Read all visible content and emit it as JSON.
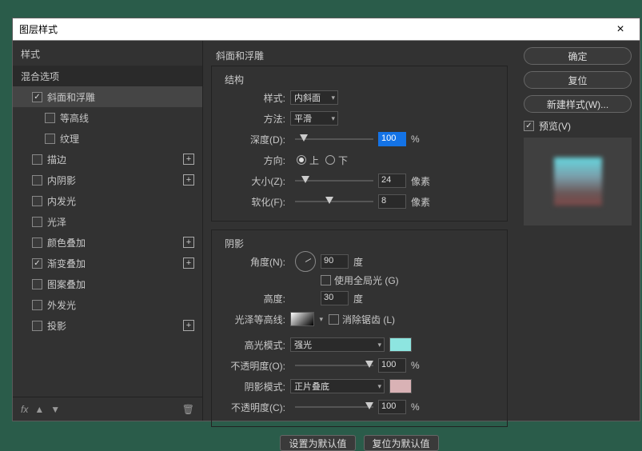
{
  "titlebar": {
    "title": "图层样式"
  },
  "left": {
    "header_styles": "样式",
    "blend_options": "混合选项",
    "items": [
      {
        "label": "斜面和浮雕",
        "checked": true,
        "selected": true
      },
      {
        "label": "等高线",
        "checked": false,
        "sub": true
      },
      {
        "label": "纹理",
        "checked": false,
        "sub": true
      },
      {
        "label": "描边",
        "checked": false,
        "add": true
      },
      {
        "label": "内阴影",
        "checked": false,
        "add": true
      },
      {
        "label": "内发光",
        "checked": false
      },
      {
        "label": "光泽",
        "checked": false
      },
      {
        "label": "颜色叠加",
        "checked": false,
        "add": true
      },
      {
        "label": "渐变叠加",
        "checked": true,
        "add": true
      },
      {
        "label": "图案叠加",
        "checked": false
      },
      {
        "label": "外发光",
        "checked": false
      },
      {
        "label": "投影",
        "checked": false,
        "add": true
      }
    ],
    "fx": "fx"
  },
  "mid": {
    "title": "斜面和浮雕",
    "structure": {
      "group": "结构",
      "style_lbl": "样式:",
      "style_val": "内斜面",
      "technique_lbl": "方法:",
      "technique_val": "平滑",
      "depth_lbl": "深度(D):",
      "depth_val": "100",
      "depth_unit": "%",
      "direction_lbl": "方向:",
      "dir_up": "上",
      "dir_down": "下",
      "size_lbl": "大小(Z):",
      "size_val": "24",
      "size_unit": "像素",
      "soften_lbl": "软化(F):",
      "soften_val": "8",
      "soften_unit": "像素"
    },
    "shading": {
      "group": "阴影",
      "angle_lbl": "角度(N):",
      "angle_val": "90",
      "angle_unit": "度",
      "global_light": "使用全局光 (G)",
      "altitude_lbl": "高度:",
      "altitude_val": "30",
      "altitude_unit": "度",
      "gloss_lbl": "光泽等高线:",
      "anti_alias": "消除锯齿 (L)",
      "hl_mode_lbl": "高光模式:",
      "hl_mode_val": "强光",
      "hl_color": "#8de5e0",
      "hl_op_lbl": "不透明度(O):",
      "hl_op_val": "100",
      "hl_op_unit": "%",
      "sh_mode_lbl": "阴影模式:",
      "sh_mode_val": "正片叠底",
      "sh_color": "#d9b2b5",
      "sh_op_lbl": "不透明度(C):",
      "sh_op_val": "100",
      "sh_op_unit": "%"
    },
    "set_default": "设置为默认值",
    "reset_default": "复位为默认值"
  },
  "right": {
    "ok": "确定",
    "cancel": "复位",
    "new_style": "新建样式(W)...",
    "preview": "预览(V)"
  }
}
